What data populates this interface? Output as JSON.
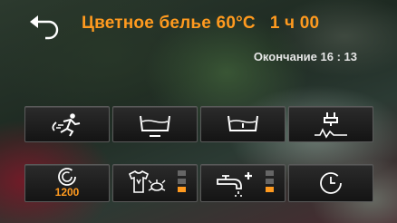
{
  "header": {
    "program_name": "Цветное белье 60°C",
    "duration": "1 ч 00",
    "end_label": "Окончание 16 : 13"
  },
  "options_row": [
    {
      "name": "quick-wash",
      "icon": "running-man-icon"
    },
    {
      "name": "prewash",
      "icon": "tub-prewash-icon"
    },
    {
      "name": "main-wash",
      "icon": "tub-mainwash-icon"
    },
    {
      "name": "extra-rinse",
      "icon": "tap-drops-icon"
    }
  ],
  "settings_row": {
    "spin": {
      "icon": "spin-icon",
      "value": "1200"
    },
    "soil_level": {
      "icon": "shirt-bug-icon",
      "level": 1,
      "max": 3
    },
    "rinse_plus": {
      "icon": "faucet-plus-icon",
      "level": 1,
      "max": 3
    },
    "delay_timer": {
      "icon": "clock-icon"
    }
  },
  "colors": {
    "accent": "#ff9a1f",
    "text_light": "#e6e6e6"
  }
}
